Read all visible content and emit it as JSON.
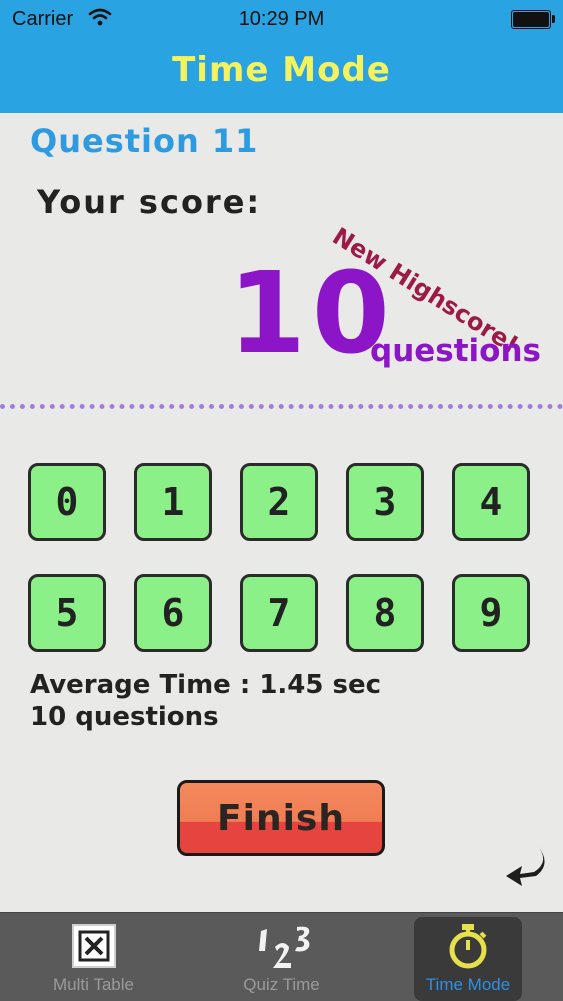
{
  "status_bar": {
    "carrier": "Carrier",
    "time": "10:29 PM"
  },
  "header": {
    "title": "Time Mode"
  },
  "quiz": {
    "question_label": "Question 11",
    "score_label": "Your score:",
    "highscore_badge": "New Highscore!",
    "score_value": "10",
    "score_unit": "questions",
    "average_time": "Average Time : 1.45 sec",
    "question_count": "10 questions",
    "finish_label": "Finish"
  },
  "keypad": {
    "keys": [
      "0",
      "1",
      "2",
      "3",
      "4",
      "5",
      "6",
      "7",
      "8",
      "9"
    ]
  },
  "tabbar": {
    "tabs": [
      {
        "label": "Multi Table",
        "icon": "x-square-icon"
      },
      {
        "label": "Quiz Time",
        "icon": "one-two-three-icon"
      },
      {
        "label": "Time Mode",
        "icon": "stopwatch-icon",
        "selected": true
      }
    ]
  },
  "colors": {
    "header": "#2aa3e3",
    "title": "#f4f25f",
    "question": "#2e9be0",
    "score": "#8c16c7",
    "highscore": "#9c1a47",
    "key": "#8cf088",
    "finish": "#e5443f",
    "tab_selected": "#2d8fe3"
  }
}
